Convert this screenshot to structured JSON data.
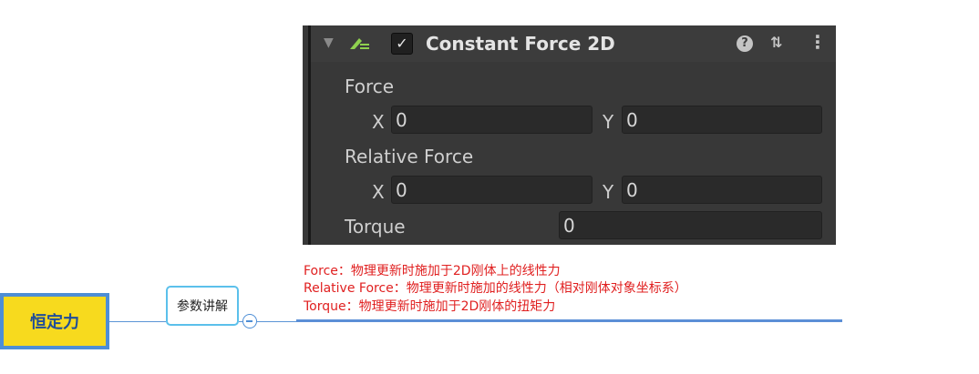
{
  "inspector": {
    "component_title": "Constant Force 2D",
    "enabled_check": "✓",
    "fold_icon": "▼",
    "header_icons": [
      "help-icon",
      "presets-icon",
      "kebab-menu-icon"
    ],
    "help_glyph": "?",
    "presets_glyph": "⇅",
    "menu_glyph": "⋮",
    "force": {
      "label": "Force",
      "x_label": "X",
      "x_value": "0",
      "y_label": "Y",
      "y_value": "0"
    },
    "relative_force": {
      "label": "Relative Force",
      "x_label": "X",
      "x_value": "0",
      "y_label": "Y",
      "y_value": "0"
    },
    "torque": {
      "label": "Torque",
      "value": "0"
    }
  },
  "descriptions": [
    "Force：物理更新时施加于2D刚体上的线性力",
    "Relative Force：物理更新时施加的线性力（相对刚体对象坐标系）",
    "Torque：物理更新时施加于2D刚体的扭矩力"
  ],
  "mindmap": {
    "main_node": "恒定力",
    "sub_node": "参数讲解"
  },
  "colors": {
    "panel_bg": "#383838",
    "desc_text": "#e02020",
    "node_fill": "#f7da1e",
    "node_border": "#4d8ed6"
  }
}
